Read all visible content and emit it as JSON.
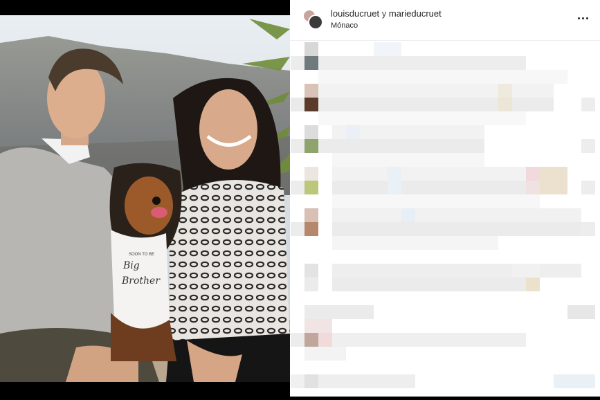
{
  "post": {
    "author1": "louisducruet",
    "joiner": "y",
    "author2": "marieducruet",
    "location": "Mónaco"
  },
  "photo": {
    "shirt_line1": "SOON TO BE",
    "shirt_line2": "Big",
    "shirt_line3": "Brother"
  },
  "icons": {
    "more": "more-horizontal-icon"
  }
}
